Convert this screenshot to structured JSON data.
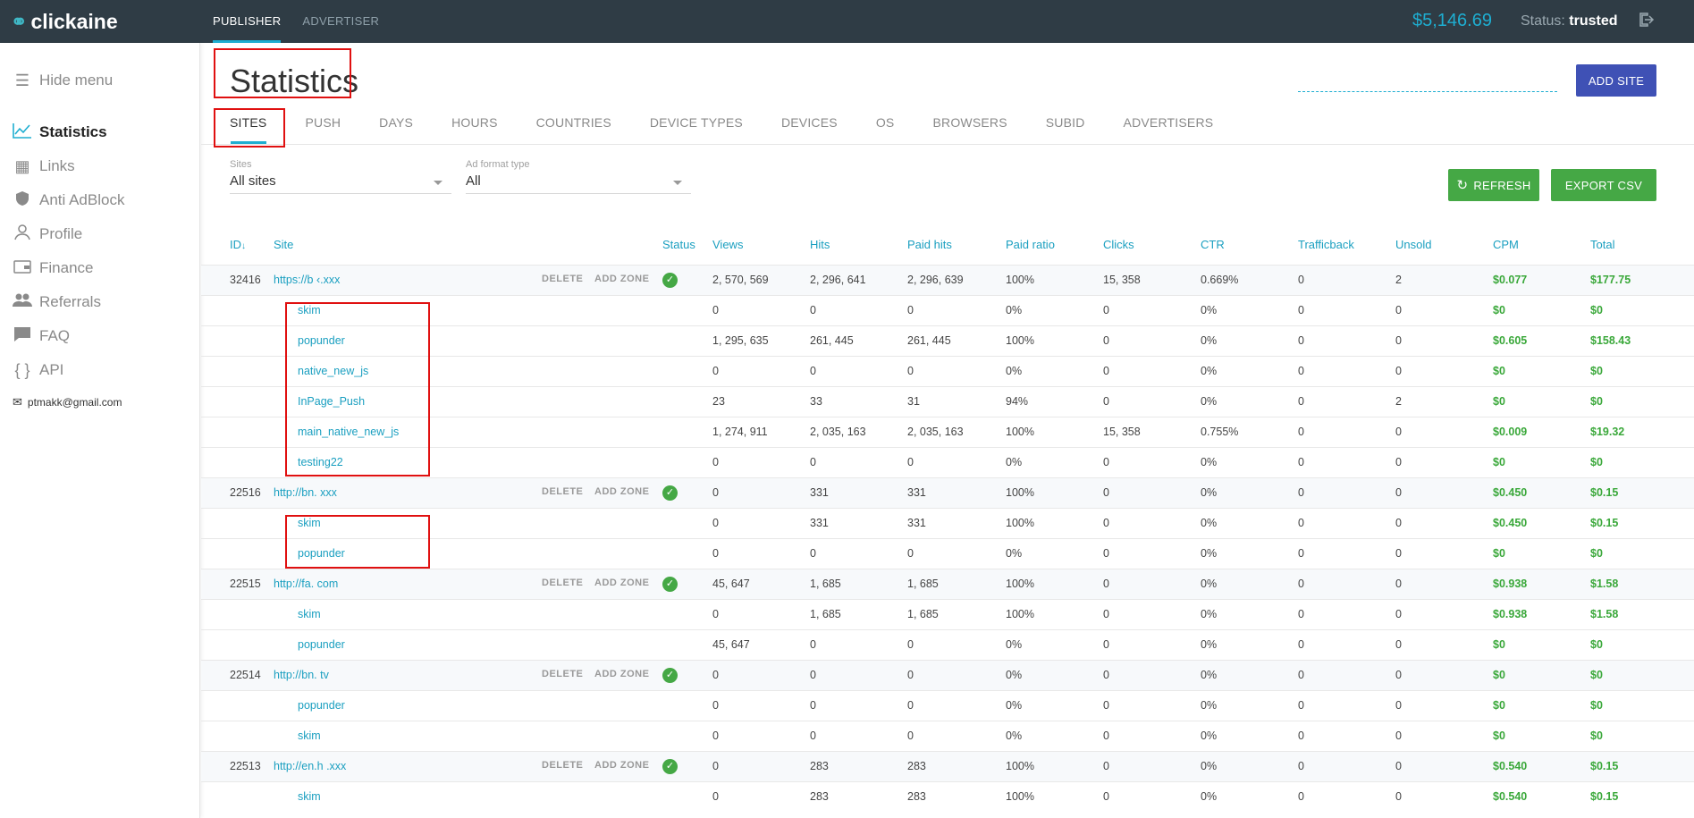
{
  "header": {
    "logo": "clickaine",
    "nav": [
      "PUBLISHER",
      "ADVERTISER"
    ],
    "balance": "$5,146.69",
    "status_label": "Status:",
    "status_value": "trusted"
  },
  "sidebar": {
    "hide_menu": "Hide menu",
    "items": [
      {
        "label": "Statistics",
        "icon": "chart-line-icon"
      },
      {
        "label": "Links",
        "icon": "calendar-grid-icon"
      },
      {
        "label": "Anti AdBlock",
        "icon": "shield-icon"
      },
      {
        "label": "Profile",
        "icon": "user-icon"
      },
      {
        "label": "Finance",
        "icon": "wallet-icon"
      },
      {
        "label": "Referrals",
        "icon": "users-icon"
      },
      {
        "label": "FAQ",
        "icon": "chat-icon"
      },
      {
        "label": "API",
        "icon": "braces-icon"
      }
    ],
    "email": "ptmakk@gmail.com"
  },
  "main": {
    "title": "Statistics",
    "add_site": "ADD SITE",
    "refresh": "REFRESH",
    "export": "EXPORT CSV",
    "tabs": [
      "SITES",
      "PUSH",
      "DAYS",
      "HOURS",
      "COUNTRIES",
      "DEVICE TYPES",
      "DEVICES",
      "OS",
      "BROWSERS",
      "SUBID",
      "ADVERTISERS"
    ],
    "filters": {
      "sites_label": "Sites",
      "sites_value": "All sites",
      "format_label": "Ad format type",
      "format_value": "All"
    },
    "columns": [
      "ID",
      "Site",
      "Status",
      "Views",
      "Hits",
      "Paid hits",
      "Paid ratio",
      "Clicks",
      "CTR",
      "Trafficback",
      "Unsold",
      "CPM",
      "Total"
    ],
    "id_sort": "↓",
    "delete": "DELETE",
    "add_zone": "ADD ZONE"
  },
  "rows": [
    {
      "type": "site",
      "id": "32416",
      "site": "https://b            ‹.xxx",
      "views": "2, 570, 569",
      "hits": "2, 296, 641",
      "paid": "2, 296, 639",
      "ratio": "100%",
      "clicks": "15, 358",
      "ctr": "0.669%",
      "tb": "0",
      "unsold": "2",
      "cpm": "$0.077",
      "total": "$177.75"
    },
    {
      "type": "zone",
      "site": "skim",
      "views": "0",
      "hits": "0",
      "paid": "0",
      "ratio": "0%",
      "clicks": "0",
      "ctr": "0%",
      "tb": "0",
      "unsold": "0",
      "cpm": "$0",
      "total": "$0"
    },
    {
      "type": "zone",
      "site": "popunder",
      "views": "1, 295, 635",
      "hits": "261, 445",
      "paid": "261, 445",
      "ratio": "100%",
      "clicks": "0",
      "ctr": "0%",
      "tb": "0",
      "unsold": "0",
      "cpm": "$0.605",
      "total": "$158.43"
    },
    {
      "type": "zone",
      "site": "native_new_js",
      "views": "0",
      "hits": "0",
      "paid": "0",
      "ratio": "0%",
      "clicks": "0",
      "ctr": "0%",
      "tb": "0",
      "unsold": "0",
      "cpm": "$0",
      "total": "$0"
    },
    {
      "type": "zone",
      "site": "InPage_Push",
      "views": "23",
      "hits": "33",
      "paid": "31",
      "ratio": "94%",
      "clicks": "0",
      "ctr": "0%",
      "tb": "0",
      "unsold": "2",
      "cpm": "$0",
      "total": "$0"
    },
    {
      "type": "zone",
      "site": "main_native_new_js",
      "views": "1, 274, 911",
      "hits": "2, 035, 163",
      "paid": "2, 035, 163",
      "ratio": "100%",
      "clicks": "15, 358",
      "ctr": "0.755%",
      "tb": "0",
      "unsold": "0",
      "cpm": "$0.009",
      "total": "$19.32"
    },
    {
      "type": "zone",
      "site": "testing22",
      "views": "0",
      "hits": "0",
      "paid": "0",
      "ratio": "0%",
      "clicks": "0",
      "ctr": "0%",
      "tb": "0",
      "unsold": "0",
      "cpm": "$0",
      "total": "$0"
    },
    {
      "type": "site",
      "id": "22516",
      "site": "http://bn.               xxx",
      "views": "0",
      "hits": "331",
      "paid": "331",
      "ratio": "100%",
      "clicks": "0",
      "ctr": "0%",
      "tb": "0",
      "unsold": "0",
      "cpm": "$0.450",
      "total": "$0.15"
    },
    {
      "type": "zone",
      "site": "skim",
      "views": "0",
      "hits": "331",
      "paid": "331",
      "ratio": "100%",
      "clicks": "0",
      "ctr": "0%",
      "tb": "0",
      "unsold": "0",
      "cpm": "$0.450",
      "total": "$0.15"
    },
    {
      "type": "zone",
      "site": "popunder",
      "views": "0",
      "hits": "0",
      "paid": "0",
      "ratio": "0%",
      "clicks": "0",
      "ctr": "0%",
      "tb": "0",
      "unsold": "0",
      "cpm": "$0",
      "total": "$0"
    },
    {
      "type": "site",
      "id": "22515",
      "site": "http://fa.            com",
      "views": "45, 647",
      "hits": "1, 685",
      "paid": "1, 685",
      "ratio": "100%",
      "clicks": "0",
      "ctr": "0%",
      "tb": "0",
      "unsold": "0",
      "cpm": "$0.938",
      "total": "$1.58"
    },
    {
      "type": "zone",
      "site": "skim",
      "views": "0",
      "hits": "1, 685",
      "paid": "1, 685",
      "ratio": "100%",
      "clicks": "0",
      "ctr": "0%",
      "tb": "0",
      "unsold": "0",
      "cpm": "$0.938",
      "total": "$1.58"
    },
    {
      "type": "zone",
      "site": "popunder",
      "views": "45, 647",
      "hits": "0",
      "paid": "0",
      "ratio": "0%",
      "clicks": "0",
      "ctr": "0%",
      "tb": "0",
      "unsold": "0",
      "cpm": "$0",
      "total": "$0"
    },
    {
      "type": "site",
      "id": "22514",
      "site": "http://bn.              tv",
      "views": "0",
      "hits": "0",
      "paid": "0",
      "ratio": "0%",
      "clicks": "0",
      "ctr": "0%",
      "tb": "0",
      "unsold": "0",
      "cpm": "$0",
      "total": "$0"
    },
    {
      "type": "zone",
      "site": "popunder",
      "views": "0",
      "hits": "0",
      "paid": "0",
      "ratio": "0%",
      "clicks": "0",
      "ctr": "0%",
      "tb": "0",
      "unsold": "0",
      "cpm": "$0",
      "total": "$0"
    },
    {
      "type": "zone",
      "site": "skim",
      "views": "0",
      "hits": "0",
      "paid": "0",
      "ratio": "0%",
      "clicks": "0",
      "ctr": "0%",
      "tb": "0",
      "unsold": "0",
      "cpm": "$0",
      "total": "$0"
    },
    {
      "type": "site",
      "id": "22513",
      "site": "http://en.h              .xxx",
      "views": "0",
      "hits": "283",
      "paid": "283",
      "ratio": "100%",
      "clicks": "0",
      "ctr": "0%",
      "tb": "0",
      "unsold": "0",
      "cpm": "$0.540",
      "total": "$0.15"
    },
    {
      "type": "zone",
      "site": "skim",
      "views": "0",
      "hits": "283",
      "paid": "283",
      "ratio": "100%",
      "clicks": "0",
      "ctr": "0%",
      "tb": "0",
      "unsold": "0",
      "cpm": "$0.540",
      "total": "$0.15"
    }
  ]
}
